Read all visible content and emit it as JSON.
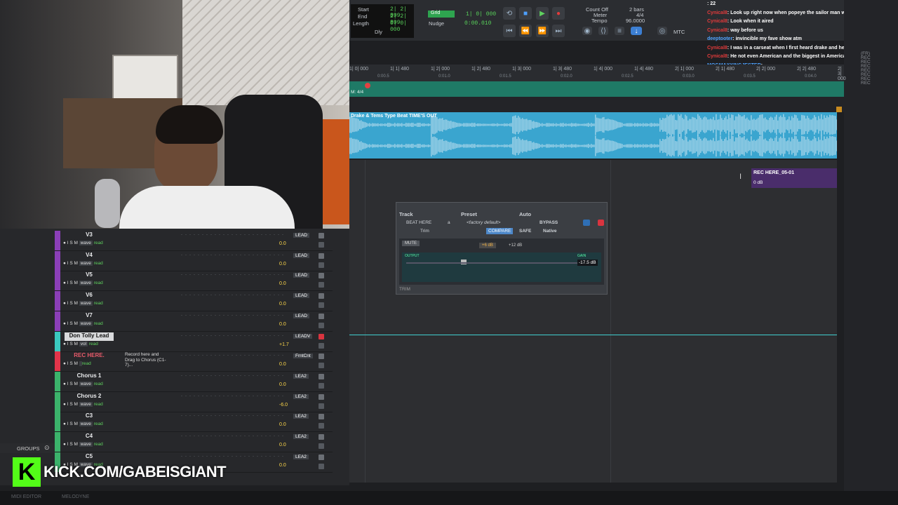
{
  "transport": {
    "start_label": "Start",
    "start_val": "2| 2| 899",
    "end_label": "End",
    "end_val": "2| 2| 899",
    "length_label": "Length",
    "length_val": "0| 0| 000",
    "dly": "Dly",
    "grid_label": "Grid",
    "grid_val": "1| 0| 000",
    "nudge_label": "Nudge",
    "nudge_val": "0:00.010",
    "countoff_label": "Count Off",
    "countoff_val": "2 bars",
    "meter_label": "Meter",
    "meter_val": "4/4",
    "tempo_label": "Tempo",
    "tempo_val": "96.0000",
    "mtc": "MTC"
  },
  "chat": [
    {
      "user": "",
      "msg": ": 22"
    },
    {
      "user": "Cynical8",
      "msg": ": Look up right now when popeye the sailor man was airing"
    },
    {
      "user": "Cynical8",
      "msg": ": Look when it aired"
    },
    {
      "user": "Cynical8",
      "msg": ": way before us"
    },
    {
      "user": "deeptooter",
      "msg": ": invincible my fave show atm",
      "blue": true
    },
    {
      "user": "Cynical8",
      "msg": ": I was in a carseat when I first heard drake and he's still the best. It's crazy"
    },
    {
      "user": "Cynical8",
      "msg": ": He not even American and the biggest in America"
    },
    {
      "user": "MOGMAXXINGJESTER",
      "msg": ":",
      "blue": true
    }
  ],
  "ruler": [
    "1| 0| 000",
    "1| 1| 480",
    "1| 2| 000",
    "1| 2| 480",
    "1| 3| 000",
    "1| 3| 480",
    "1| 4| 000",
    "1| 4| 480",
    "2| 1| 000",
    "2| 1| 480",
    "2| 2| 000",
    "2| 2| 480",
    "2| 3| 000"
  ],
  "ruler_secs": [
    "0:00.5",
    "0:01.0",
    "0:01.5",
    "0:02.0",
    "0:02.5",
    "0:03.0",
    "0:03.5",
    "0:04.0"
  ],
  "meter_track": "M: 4/4",
  "clip_title": "Drake & Tems Type Beat TIME'S OUT",
  "rec_region": {
    "name": "REC HERE_05-01",
    "gain": "0 dB"
  },
  "plugin": {
    "track_label": "Track",
    "preset_label": "Preset",
    "auto_label": "Auto",
    "track_name": "BEAT HERE",
    "track_slot": "a",
    "preset_name": "<factory default>",
    "bypass": "BYPASS",
    "compare": "COMPARE",
    "safe": "SAFE",
    "native": "Native",
    "plugin_name": "Trim",
    "mute": "MUTE",
    "gain_a": "+6 dB",
    "gain_b": "+12 dB",
    "output_label": "OUTPUT",
    "gain_label": "GAIN",
    "gain_val": "-17.5 dB",
    "footer": "TRIM"
  },
  "tracks": [
    {
      "name": "V3",
      "vol": "0.0",
      "io": "LEAD",
      "kind": "wave",
      "color": "#8b3fb8"
    },
    {
      "name": "V4",
      "vol": "0.0",
      "io": "LEAD",
      "kind": "wave",
      "color": "#8b3fb8"
    },
    {
      "name": "V5",
      "vol": "0.0",
      "io": "LEAD",
      "kind": "wave",
      "color": "#8b3fb8"
    },
    {
      "name": "V6",
      "vol": "0.0",
      "io": "LEAD",
      "kind": "wave",
      "color": "#8b3fb8"
    },
    {
      "name": "V7",
      "vol": "0.0",
      "io": "LEAD",
      "kind": "wave",
      "color": "#8b3fb8"
    },
    {
      "name": "Don Tolly Lead",
      "vol": "+1.7",
      "io": "LEADV",
      "kind": "vol",
      "color": "#3ac9c0"
    },
    {
      "name": "REC HERE.",
      "vol": "0.0",
      "io": "FrntCnt",
      "kind": "",
      "color": "#e2344a"
    },
    {
      "name": "Chorus 1",
      "vol": "0.0",
      "io": "LEA2",
      "kind": "wave",
      "color": "#3bb36b"
    },
    {
      "name": "Chorus 2",
      "vol": "-6.0",
      "io": "LEA2",
      "kind": "wave",
      "color": "#3bb36b"
    },
    {
      "name": "C3",
      "vol": "0.0",
      "io": "LEA2",
      "kind": "wave",
      "color": "#3bb36b"
    },
    {
      "name": "C4",
      "vol": "0.0",
      "io": "LEA2",
      "kind": "wave",
      "color": "#3bb36b"
    },
    {
      "name": "C5",
      "vol": "0.0",
      "io": "LEA2",
      "kind": "wave",
      "color": "#3bb36b"
    }
  ],
  "track_btns": "● I S M",
  "read": "read",
  "rec_note": "Record here and Drag to Chorus (C1-7)...",
  "groups": "GROUPS",
  "kick_text": "KICK.COM/GABEISGIANT",
  "bottom": {
    "midi": "MIDI EDITOR",
    "melodyne": "MELODYNE"
  }
}
